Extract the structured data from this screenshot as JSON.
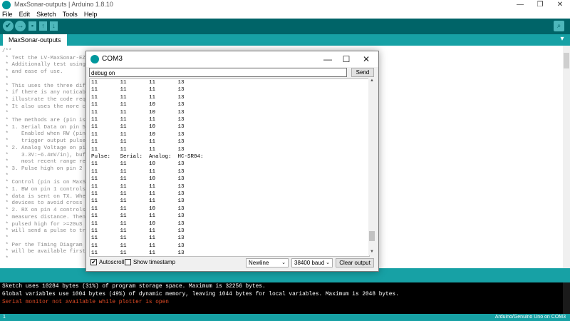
{
  "window": {
    "title": "MaxSonar-outputs | Arduino 1.8.10",
    "minimize": "—",
    "maximize": "❐",
    "close": "✕"
  },
  "menu": [
    "File",
    "Edit",
    "Sketch",
    "Tools",
    "Help"
  ],
  "toolbar": {
    "verify_icon": "✔",
    "upload_icon": "→",
    "new_icon": "▪",
    "open_icon": "↑",
    "save_icon": "↓",
    "serial_icon": "⌕"
  },
  "tab": {
    "label": "MaxSonar-outputs",
    "menu_icon": "▾"
  },
  "editor": {
    "lines": [
      "/**",
      " * Test the LV-MaxSonar-EZ se",
      " * Additionally test using th",
      " * and ease of use.",
      " *",
      " * This uses the three differ",
      " * if there is any noticable ",
      " * illustrate the code requir",
      " * It also uses the more comm",
      " *",
      " * The methods are (pin is on",
      " * 1. Serial Data on pin 5. R",
      " *    Enabled when RW (pin 1)",
      " *    trigger output pulse fo",
      " * 2. Analog Voltage on pin 3",
      " *    3.3V:~6.4mV/in), buffer",
      " *    most recent range readi",
      " * 3. Pulse high on pin 2 at ",
      " *",
      " * Control (pin is on MaxSona",
      " * 1. BW on pin 1 controls th",
      " * data is sent on TX. When p",
      " * devices to avoid cross nev",
      " * 2. RX on pin 4 controls th",
      " * measures distance. Then he",
      " * pulsed high for >=20uS the",
      " * will send a pulse to trigg",
      " *",
      " * Per the Timing Diagram and",
      " * will be available first an",
      " *"
    ]
  },
  "serial_monitor": {
    "title": "COM3",
    "input_value": "debug on",
    "send_label": "Send",
    "rows": [
      "11       11       11       13",
      "11       11       11       13",
      "11       11       11       13",
      "11       11       10       13",
      "11       11       10       13",
      "11       11       11       13",
      "11       11       10       13",
      "11       11       10       13",
      "11       11       11       13",
      "11       11       11       13",
      "Pulse:   Serial:  Analog:  HC-SR04:",
      "11       11       10       13",
      "11       11       11       13",
      "11       11       10       13",
      "11       11       11       13",
      "11       11       11       13",
      "11       11       11       13",
      "11       11       10       13",
      "11       11       11       13",
      "11       11       10       13",
      "11       11       11       13",
      "11       11       11       13",
      "11       11       11       13",
      "11       11       11       13"
    ],
    "autoscroll_label": "Autoscroll",
    "autoscroll_checked": "✔",
    "timestamp_label": "Show timestamp",
    "line_ending": "Newline",
    "baud": "38400 baud",
    "clear_label": "Clear output",
    "dropdown_arrow": "⌄"
  },
  "console": {
    "line1": "Sketch uses 10284 bytes (31%) of program storage space. Maximum is 32256 bytes.",
    "line2": "Global variables use 1004 bytes (49%) of dynamic memory, leaving 1044 bytes for local variables. Maximum is 2048 bytes.",
    "line3": "Serial monitor not available while plotter is open",
    "line3_color": "#e34c26"
  },
  "status": {
    "line_number": "1",
    "board": "Arduino/Genuino Uno on COM3"
  }
}
